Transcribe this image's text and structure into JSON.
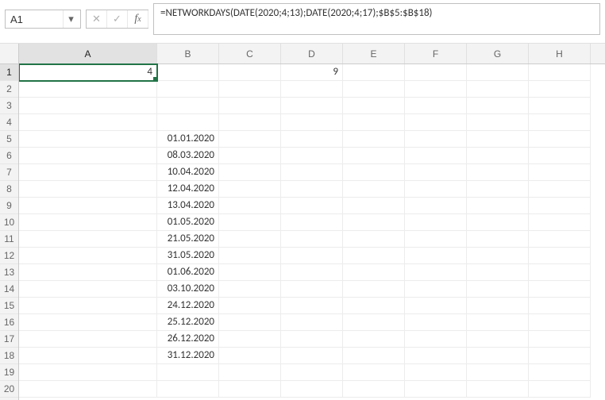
{
  "nameBox": {
    "value": "A1"
  },
  "formulaBar": {
    "value": "=NETWORKDAYS(DATE(2020;4;13);DATE(2020;4;17);$B$5:$B$18)"
  },
  "columns": [
    "A",
    "B",
    "C",
    "D",
    "E",
    "F",
    "G",
    "H"
  ],
  "rowCount": 20,
  "highlight": {
    "col": "A",
    "row": 1
  },
  "cells": {
    "A1": "4",
    "D1": "9",
    "B5": "01.01.2020",
    "B6": "08.03.2020",
    "B7": "10.04.2020",
    "B8": "12.04.2020",
    "B9": "13.04.2020",
    "B10": "01.05.2020",
    "B11": "21.05.2020",
    "B12": "31.05.2020",
    "B13": "01.06.2020",
    "B14": "03.10.2020",
    "B15": "24.12.2020",
    "B16": "25.12.2020",
    "B17": "26.12.2020",
    "B18": "31.12.2020"
  }
}
